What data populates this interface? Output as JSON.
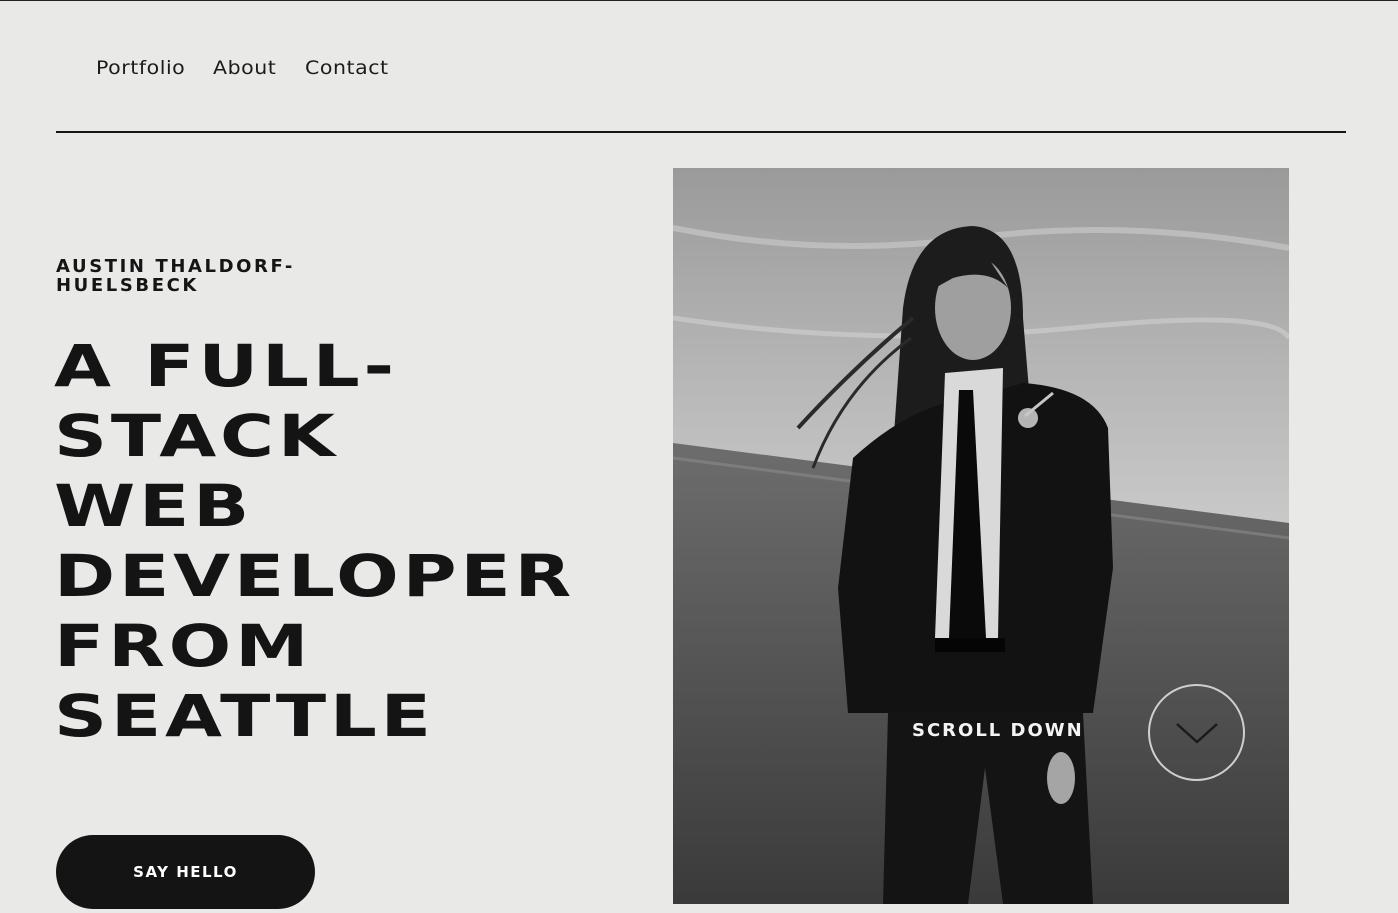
{
  "nav": {
    "items": [
      {
        "label": "Portfolio"
      },
      {
        "label": "About"
      },
      {
        "label": "Contact"
      }
    ]
  },
  "hero": {
    "name": "AUSTIN THALDORF-HUELSBECK",
    "headline_lines": [
      "A FULL-",
      "STACK",
      "WEB",
      "DEVELOPER",
      "FROM",
      "SEATTLE"
    ],
    "cta_label": "SAY HELLO",
    "scroll_label": "SCROLL DOWN",
    "scroll_icon": "chevron-down-icon",
    "photo_alt": "portrait"
  },
  "colors": {
    "background": "#e9eae8",
    "text": "#141414",
    "button_bg": "#141414",
    "button_text": "#ffffff"
  }
}
